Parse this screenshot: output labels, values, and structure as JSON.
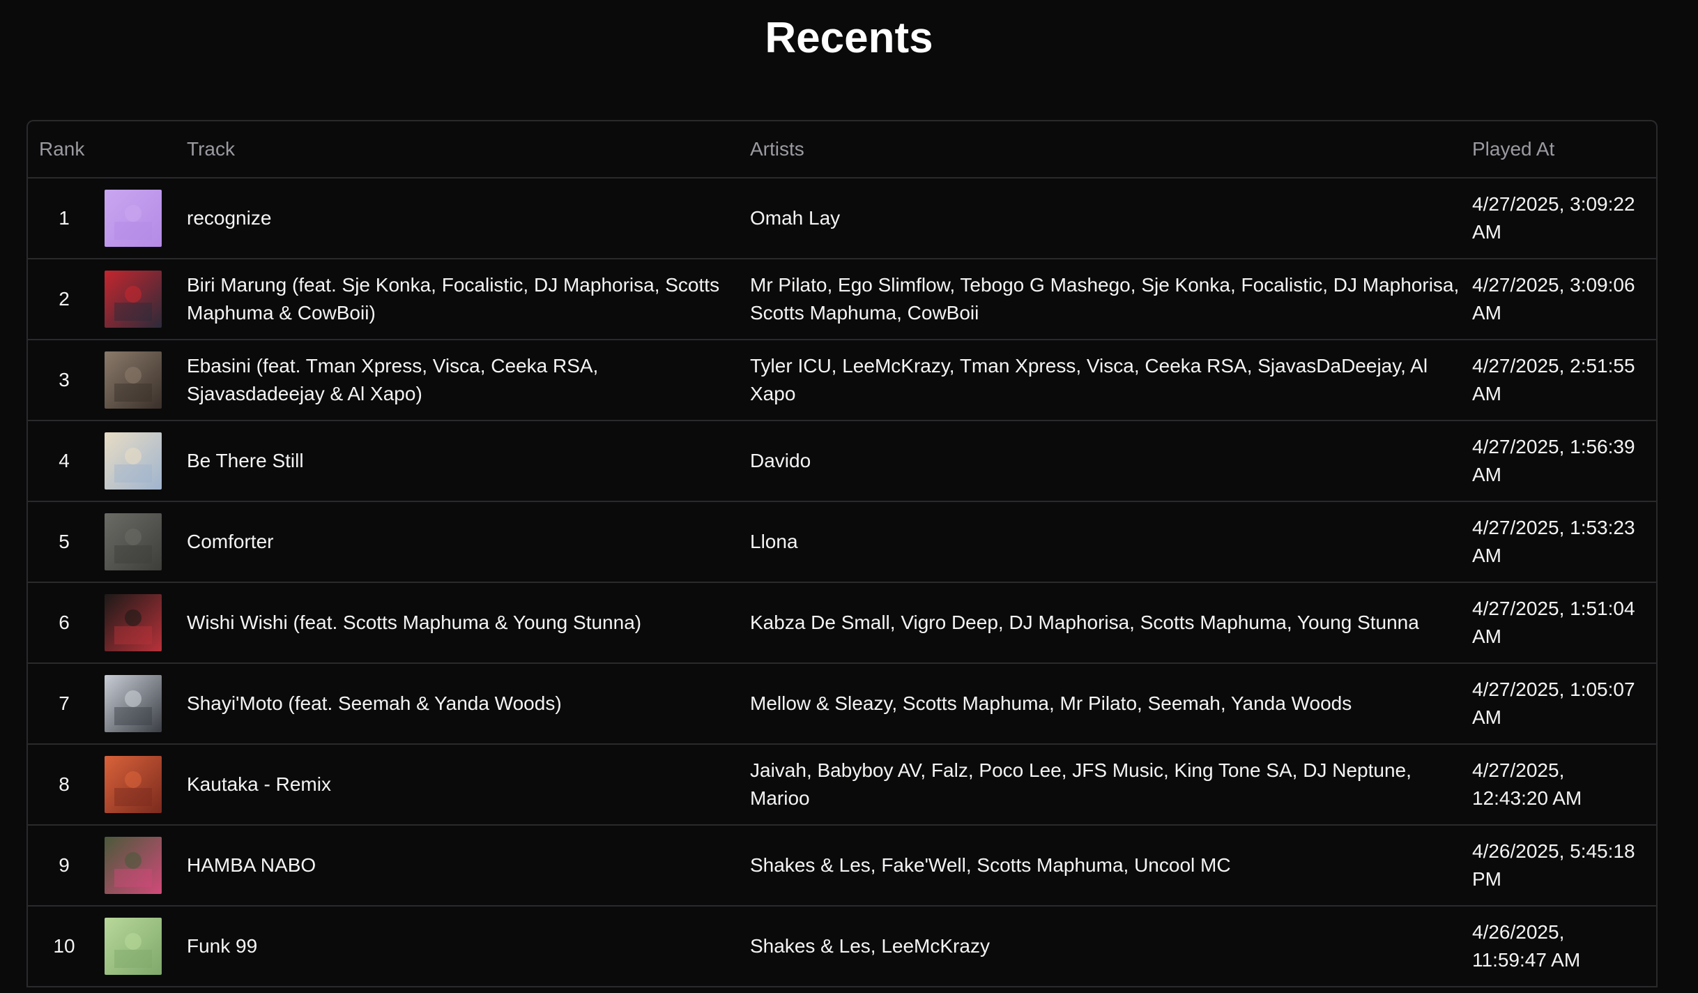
{
  "page": {
    "title": "Recents"
  },
  "table": {
    "columns": {
      "rank": "Rank",
      "track": "Track",
      "artists": "Artists",
      "played_at": "Played At"
    },
    "rows": [
      {
        "rank": "1",
        "track": "recognize",
        "artists": "Omah Lay",
        "played_at": "4/27/2025, 3:09:22 AM",
        "art_colors": [
          "#c9a6f0",
          "#b48ae6"
        ]
      },
      {
        "rank": "2",
        "track": "Biri Marung (feat. Sje Konka, Focalistic, DJ Maphorisa, Scotts Maphuma & CowBoii)",
        "artists": "Mr Pilato, Ego Slimflow, Tebogo G Mashego, Sje Konka, Focalistic, DJ Maphorisa, Scotts Maphuma, CowBoii",
        "played_at": "4/27/2025, 3:09:06 AM",
        "art_colors": [
          "#c4262e",
          "#2b2b3a"
        ]
      },
      {
        "rank": "3",
        "track": "Ebasini (feat. Tman Xpress, Visca, Ceeka RSA, Sjavasdadeejay & Al Xapo)",
        "artists": "Tyler ICU, LeeMcKrazy, Tman Xpress, Visca, Ceeka RSA, SjavasDaDeejay, Al Xapo",
        "played_at": "4/27/2025, 2:51:55 AM",
        "art_colors": [
          "#8a7a6a",
          "#3a302a"
        ]
      },
      {
        "rank": "4",
        "track": "Be There Still",
        "artists": "Davido",
        "played_at": "4/27/2025, 1:56:39 AM",
        "art_colors": [
          "#e8dcc4",
          "#9fb4cf"
        ]
      },
      {
        "rank": "5",
        "track": "Comforter",
        "artists": "Llona",
        "played_at": "4/27/2025, 1:53:23 AM",
        "art_colors": [
          "#6b6b66",
          "#3d3d3a"
        ]
      },
      {
        "rank": "6",
        "track": "Wishi Wishi (feat. Scotts Maphuma & Young Stunna)",
        "artists": "Kabza De Small, Vigro Deep, DJ Maphorisa, Scotts Maphuma, Young Stunna",
        "played_at": "4/27/2025, 1:51:04 AM",
        "art_colors": [
          "#1c1a18",
          "#b8323a"
        ]
      },
      {
        "rank": "7",
        "track": "Shayi'Moto (feat. Seemah & Yanda Woods)",
        "artists": "Mellow & Sleazy, Scotts Maphuma, Mr Pilato, Seemah, Yanda Woods",
        "played_at": "4/27/2025, 1:05:07 AM",
        "art_colors": [
          "#c9ced6",
          "#3a3d44"
        ]
      },
      {
        "rank": "8",
        "track": "Kautaka - Remix",
        "artists": "Jaivah, Babyboy AV, Falz, Poco Lee, JFS Music, King Tone SA, DJ Neptune, Marioo",
        "played_at": "4/27/2025, 12:43:20 AM",
        "art_colors": [
          "#d9623a",
          "#7a2a1e"
        ]
      },
      {
        "rank": "9",
        "track": "HAMBA NABO",
        "artists": "Shakes & Les, Fake'Well, Scotts Maphuma, Uncool MC",
        "played_at": "4/26/2025, 5:45:18 PM",
        "art_colors": [
          "#4a5a3a",
          "#d14a7a"
        ]
      },
      {
        "rank": "10",
        "track": "Funk 99",
        "artists": "Shakes & Les, LeeMcKrazy",
        "played_at": "4/26/2025, 11:59:47 AM",
        "art_colors": [
          "#b8d89a",
          "#7ea86a"
        ]
      }
    ]
  }
}
